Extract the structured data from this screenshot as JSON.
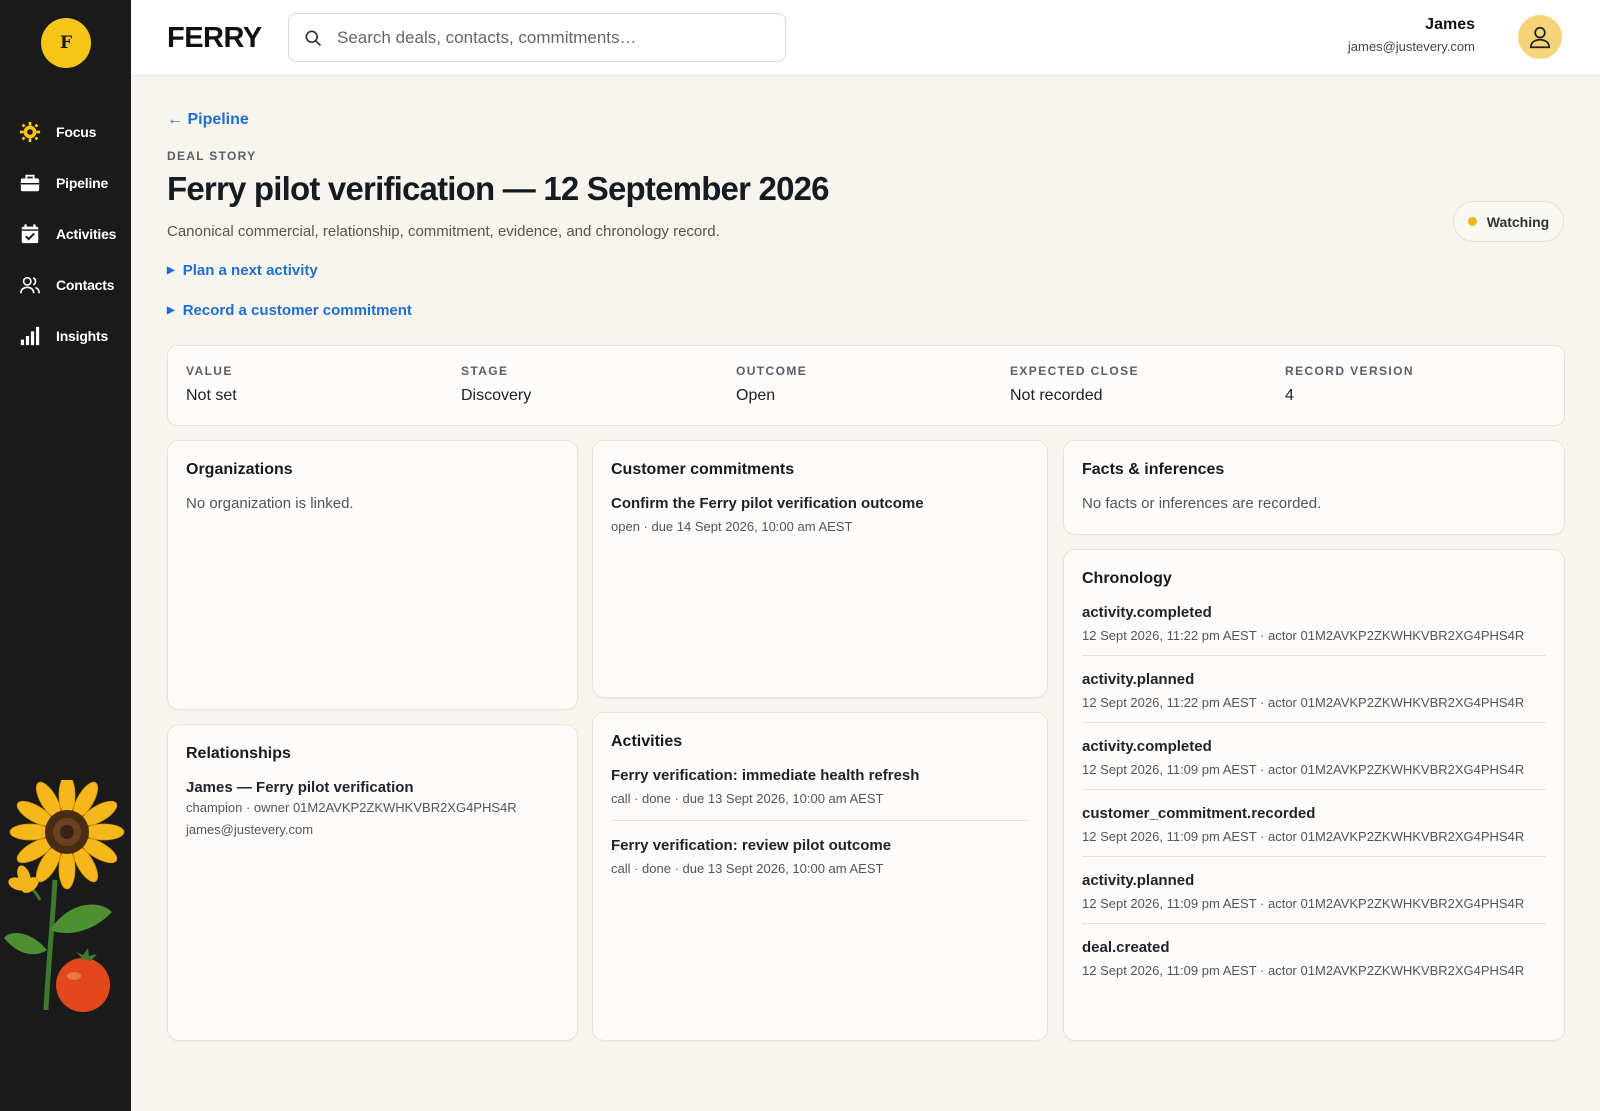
{
  "app": {
    "logo_letter": "F",
    "brand": "FERRY"
  },
  "sidebar": {
    "items": [
      {
        "label": "Focus",
        "icon": "sun-gear-icon"
      },
      {
        "label": "Pipeline",
        "icon": "briefcase-icon"
      },
      {
        "label": "Activities",
        "icon": "calendar-check-icon"
      },
      {
        "label": "Contacts",
        "icon": "users-icon"
      },
      {
        "label": "Insights",
        "icon": "bar-chart-icon"
      }
    ]
  },
  "header": {
    "search_placeholder": "Search deals, contacts, commitments…",
    "user_name": "James",
    "user_email": "james@justevery.com"
  },
  "page": {
    "back_label": "← Pipeline",
    "eyebrow": "DEAL STORY",
    "title": "Ferry pilot verification — 12 September 2026",
    "subtitle": "Canonical commercial, relationship, commitment, evidence, and chronology record.",
    "disclosure_1": "Plan a next activity",
    "disclosure_2": "Record a customer commitment",
    "watch_label": "Watching",
    "watch_color": "#f2b50f"
  },
  "summary": [
    {
      "label": "VALUE",
      "value": "Not set"
    },
    {
      "label": "STAGE",
      "value": "Discovery"
    },
    {
      "label": "OUTCOME",
      "value": "Open"
    },
    {
      "label": "EXPECTED CLOSE",
      "value": "Not recorded"
    },
    {
      "label": "RECORD VERSION",
      "value": "4"
    }
  ],
  "organizations": {
    "title": "Organizations",
    "empty": "No organization is linked."
  },
  "relationships": {
    "title": "Relationships",
    "name": "James — Ferry pilot verification",
    "meta": "champion · owner 01M2AVKP2ZKWHKVBR2XG4PHS4R",
    "email": "james@justevery.com"
  },
  "commitments": {
    "title": "Customer commitments",
    "items": [
      {
        "title": "Confirm the Ferry pilot verification outcome",
        "meta": "open · due 14 Sept 2026, 10:00 am AEST"
      }
    ]
  },
  "activities": {
    "title": "Activities",
    "items": [
      {
        "title": "Ferry verification: immediate health refresh",
        "meta": "call · done · due 13 Sept 2026, 10:00 am AEST"
      },
      {
        "title": "Ferry verification: review pilot outcome",
        "meta": "call · done · due 13 Sept 2026, 10:00 am AEST"
      }
    ]
  },
  "facts": {
    "title": "Facts & inferences",
    "empty": "No facts or inferences are recorded."
  },
  "chronology": {
    "title": "Chronology",
    "items": [
      {
        "event": "activity.completed",
        "meta": "12 Sept 2026, 11:22 pm AEST · actor 01M2AVKP2ZKWHKVBR2XG4PHS4R"
      },
      {
        "event": "activity.planned",
        "meta": "12 Sept 2026, 11:22 pm AEST · actor 01M2AVKP2ZKWHKVBR2XG4PHS4R"
      },
      {
        "event": "activity.completed",
        "meta": "12 Sept 2026, 11:09 pm AEST · actor 01M2AVKP2ZKWHKVBR2XG4PHS4R"
      },
      {
        "event": "customer_commitment.recorded",
        "meta": "12 Sept 2026, 11:09 pm AEST · actor 01M2AVKP2ZKWHKVBR2XG4PHS4R"
      },
      {
        "event": "activity.planned",
        "meta": "12 Sept 2026, 11:09 pm AEST · actor 01M2AVKP2ZKWHKVBR2XG4PHS4R"
      },
      {
        "event": "deal.created",
        "meta": "12 Sept 2026, 11:09 pm AEST · actor 01M2AVKP2ZKWHKVBR2XG4PHS4R"
      }
    ]
  }
}
